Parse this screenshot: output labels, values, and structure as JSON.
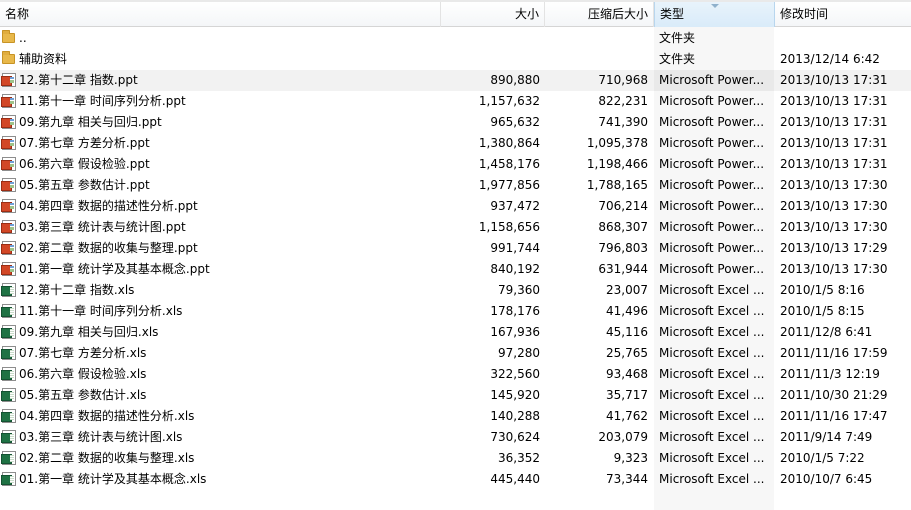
{
  "columns": {
    "name": "名称",
    "size": "大小",
    "compressed": "压缩后大小",
    "type": "类型",
    "modified": "修改时间"
  },
  "files": [
    {
      "icon": "folder-icon",
      "name": "..",
      "size": "",
      "compressed": "",
      "type": "文件夹",
      "modified": ""
    },
    {
      "icon": "folder-icon",
      "name": "辅助资料",
      "size": "",
      "compressed": "",
      "type": "文件夹",
      "modified": "2013/12/14 6:42"
    },
    {
      "icon": "ppt-icon",
      "name": "12.第十二章 指数.ppt",
      "size": "890,880",
      "compressed": "710,968",
      "type": "Microsoft Power...",
      "modified": "2013/10/13 17:31",
      "selected": true
    },
    {
      "icon": "ppt-icon",
      "name": "11.第十一章 时间序列分析.ppt",
      "size": "1,157,632",
      "compressed": "822,231",
      "type": "Microsoft Power...",
      "modified": "2013/10/13 17:31"
    },
    {
      "icon": "ppt-icon",
      "name": "09.第九章 相关与回归.ppt",
      "size": "965,632",
      "compressed": "741,390",
      "type": "Microsoft Power...",
      "modified": "2013/10/13 17:31"
    },
    {
      "icon": "ppt-icon",
      "name": "07.第七章 方差分析.ppt",
      "size": "1,380,864",
      "compressed": "1,095,378",
      "type": "Microsoft Power...",
      "modified": "2013/10/13 17:31"
    },
    {
      "icon": "ppt-icon",
      "name": "06.第六章 假设检验.ppt",
      "size": "1,458,176",
      "compressed": "1,198,466",
      "type": "Microsoft Power...",
      "modified": "2013/10/13 17:31"
    },
    {
      "icon": "ppt-icon",
      "name": "05.第五章 参数估计.ppt",
      "size": "1,977,856",
      "compressed": "1,788,165",
      "type": "Microsoft Power...",
      "modified": "2013/10/13 17:30"
    },
    {
      "icon": "ppt-icon",
      "name": "04.第四章 数据的描述性分析.ppt",
      "size": "937,472",
      "compressed": "706,214",
      "type": "Microsoft Power...",
      "modified": "2013/10/13 17:30"
    },
    {
      "icon": "ppt-icon",
      "name": "03.第三章 统计表与统计图.ppt",
      "size": "1,158,656",
      "compressed": "868,307",
      "type": "Microsoft Power...",
      "modified": "2013/10/13 17:30"
    },
    {
      "icon": "ppt-icon",
      "name": "02.第二章 数据的收集与整理.ppt",
      "size": "991,744",
      "compressed": "796,803",
      "type": "Microsoft Power...",
      "modified": "2013/10/13 17:29"
    },
    {
      "icon": "ppt-icon",
      "name": "01.第一章 统计学及其基本概念.ppt",
      "size": "840,192",
      "compressed": "631,944",
      "type": "Microsoft Power...",
      "modified": "2013/10/13 17:30"
    },
    {
      "icon": "xls-icon",
      "name": "12.第十二章 指数.xls",
      "size": "79,360",
      "compressed": "23,007",
      "type": "Microsoft Excel ...",
      "modified": "2010/1/5 8:16"
    },
    {
      "icon": "xls-icon",
      "name": "11.第十一章 时间序列分析.xls",
      "size": "178,176",
      "compressed": "41,496",
      "type": "Microsoft Excel ...",
      "modified": "2010/1/5 8:15"
    },
    {
      "icon": "xls-icon",
      "name": "09.第九章 相关与回归.xls",
      "size": "167,936",
      "compressed": "45,116",
      "type": "Microsoft Excel ...",
      "modified": "2011/12/8 6:41"
    },
    {
      "icon": "xls-icon",
      "name": "07.第七章 方差分析.xls",
      "size": "97,280",
      "compressed": "25,765",
      "type": "Microsoft Excel ...",
      "modified": "2011/11/16 17:59"
    },
    {
      "icon": "xls-icon",
      "name": "06.第六章 假设检验.xls",
      "size": "322,560",
      "compressed": "93,468",
      "type": "Microsoft Excel ...",
      "modified": "2011/11/3 12:19"
    },
    {
      "icon": "xls-icon",
      "name": "05.第五章 参数估计.xls",
      "size": "145,920",
      "compressed": "35,717",
      "type": "Microsoft Excel ...",
      "modified": "2011/10/30 21:29"
    },
    {
      "icon": "xls-icon",
      "name": "04.第四章 数据的描述性分析.xls",
      "size": "140,288",
      "compressed": "41,762",
      "type": "Microsoft Excel ...",
      "modified": "2011/11/16 17:47"
    },
    {
      "icon": "xls-icon",
      "name": "03.第三章 统计表与统计图.xls",
      "size": "730,624",
      "compressed": "203,079",
      "type": "Microsoft Excel ...",
      "modified": "2011/9/14 7:49"
    },
    {
      "icon": "xls-icon",
      "name": "02.第二章 数据的收集与整理.xls",
      "size": "36,352",
      "compressed": "9,323",
      "type": "Microsoft Excel ...",
      "modified": "2010/1/5 7:22"
    },
    {
      "icon": "xls-icon",
      "name": "01.第一章 统计学及其基本概念.xls",
      "size": "445,440",
      "compressed": "73,344",
      "type": "Microsoft Excel ...",
      "modified": "2010/10/7 6:45"
    }
  ]
}
